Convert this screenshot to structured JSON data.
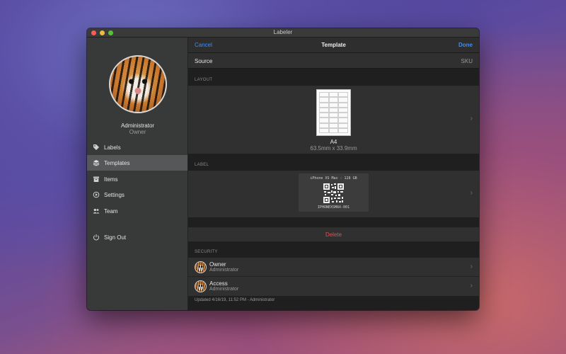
{
  "window": {
    "title": "Labeler"
  },
  "sidebar": {
    "profile": {
      "name": "Administrator",
      "role": "Owner"
    },
    "items": [
      {
        "label": "Labels",
        "icon": "tag-icon"
      },
      {
        "label": "Templates",
        "icon": "layers-icon",
        "active": true
      },
      {
        "label": "Items",
        "icon": "archive-box-icon"
      },
      {
        "label": "Settings",
        "icon": "settings-circle-icon"
      },
      {
        "label": "Team",
        "icon": "people-icon"
      }
    ],
    "sign_out": {
      "label": "Sign Out",
      "icon": "power-icon"
    }
  },
  "topbar": {
    "cancel": "Cancel",
    "title": "Template",
    "done": "Done"
  },
  "source": {
    "label": "Source",
    "value": "SKU"
  },
  "layout": {
    "header": "LAYOUT",
    "name": "A4",
    "size": "63.5mm x 33.9mm"
  },
  "label": {
    "header": "LABEL",
    "top_text": "iPhone XS Max - 128 GB",
    "code_text": "IPHONEXSMAX-001"
  },
  "delete_label": "Delete",
  "security": {
    "header": "SECURITY",
    "rows": [
      {
        "name": "Owner",
        "role": "Administrator"
      },
      {
        "name": "Access",
        "role": "Administrator"
      }
    ]
  },
  "footer": "Updated 4/16/19, 11:52 PM - Administrator",
  "colors": {
    "accent": "#3f8ef0",
    "destructive": "#ec4b4b",
    "sidebar_active": "#555758"
  }
}
